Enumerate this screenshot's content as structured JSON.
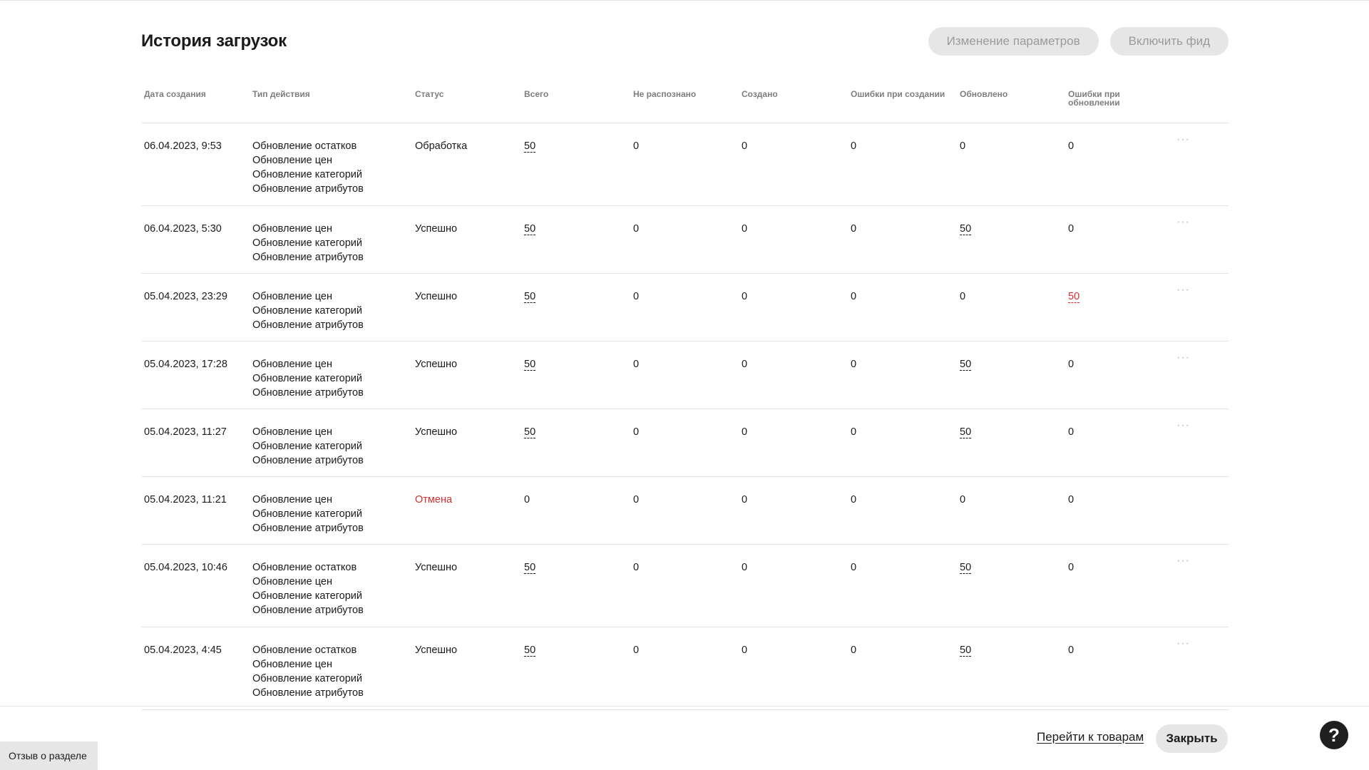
{
  "header": {
    "title": "История загрузок",
    "change_params_label": "Изменение параметров",
    "enable_feed_label": "Включить фид"
  },
  "table": {
    "columns": [
      "Дата создания",
      "Тип действия",
      "Статус",
      "Всего",
      "Не распознано",
      "Создано",
      "Ошибки при создании",
      "Обновлено",
      "Ошибки при обновлении"
    ],
    "rows": [
      {
        "date": "06.04.2023, 9:53",
        "types": [
          "Обновление остатков",
          "Обновление цен",
          "Обновление категорий",
          "Обновление атрибутов"
        ],
        "status": "Обработка",
        "total": "50",
        "unrecognized": "0",
        "created": "0",
        "create_errors": "0",
        "updated": "0",
        "update_errors": "0"
      },
      {
        "date": "06.04.2023, 5:30",
        "types": [
          "Обновление цен",
          "Обновление категорий",
          "Обновление атрибутов"
        ],
        "status": "Успешно",
        "total": "50",
        "unrecognized": "0",
        "created": "0",
        "create_errors": "0",
        "updated": "50",
        "update_errors": "0"
      },
      {
        "date": "05.04.2023, 23:29",
        "types": [
          "Обновление цен",
          "Обновление категорий",
          "Обновление атрибутов"
        ],
        "status": "Успешно",
        "total": "50",
        "unrecognized": "0",
        "created": "0",
        "create_errors": "0",
        "updated": "0",
        "update_errors": "50"
      },
      {
        "date": "05.04.2023, 17:28",
        "types": [
          "Обновление цен",
          "Обновление категорий",
          "Обновление атрибутов"
        ],
        "status": "Успешно",
        "total": "50",
        "unrecognized": "0",
        "created": "0",
        "create_errors": "0",
        "updated": "50",
        "update_errors": "0"
      },
      {
        "date": "05.04.2023, 11:27",
        "types": [
          "Обновление цен",
          "Обновление категорий",
          "Обновление атрибутов"
        ],
        "status": "Успешно",
        "total": "50",
        "unrecognized": "0",
        "created": "0",
        "create_errors": "0",
        "updated": "50",
        "update_errors": "0"
      },
      {
        "date": "05.04.2023, 11:21",
        "types": [
          "Обновление цен",
          "Обновление категорий",
          "Обновление атрибутов"
        ],
        "status": "Отмена",
        "total": "0",
        "unrecognized": "0",
        "created": "0",
        "create_errors": "0",
        "updated": "0",
        "update_errors": "0"
      },
      {
        "date": "05.04.2023, 10:46",
        "types": [
          "Обновление остатков",
          "Обновление цен",
          "Обновление категорий",
          "Обновление атрибутов"
        ],
        "status": "Успешно",
        "total": "50",
        "unrecognized": "0",
        "created": "0",
        "create_errors": "0",
        "updated": "50",
        "update_errors": "0"
      },
      {
        "date": "05.04.2023, 4:45",
        "types": [
          "Обновление остатков",
          "Обновление цен",
          "Обновление категорий",
          "Обновление атрибутов"
        ],
        "status": "Успешно",
        "total": "50",
        "unrecognized": "0",
        "created": "0",
        "create_errors": "0",
        "updated": "50",
        "update_errors": "0"
      }
    ]
  },
  "footer": {
    "goto_products_label": "Перейти к товарам",
    "close_label": "Закрыть",
    "help_label": "?",
    "feedback_label": "Отзыв о разделе"
  },
  "colors": {
    "error_red": "#d62c2c",
    "button_bg": "#e6e6e6",
    "header_text_gray": "#7e7e7e"
  },
  "icons": {
    "row_menu": "more-dots-icon",
    "help": "question-icon"
  }
}
